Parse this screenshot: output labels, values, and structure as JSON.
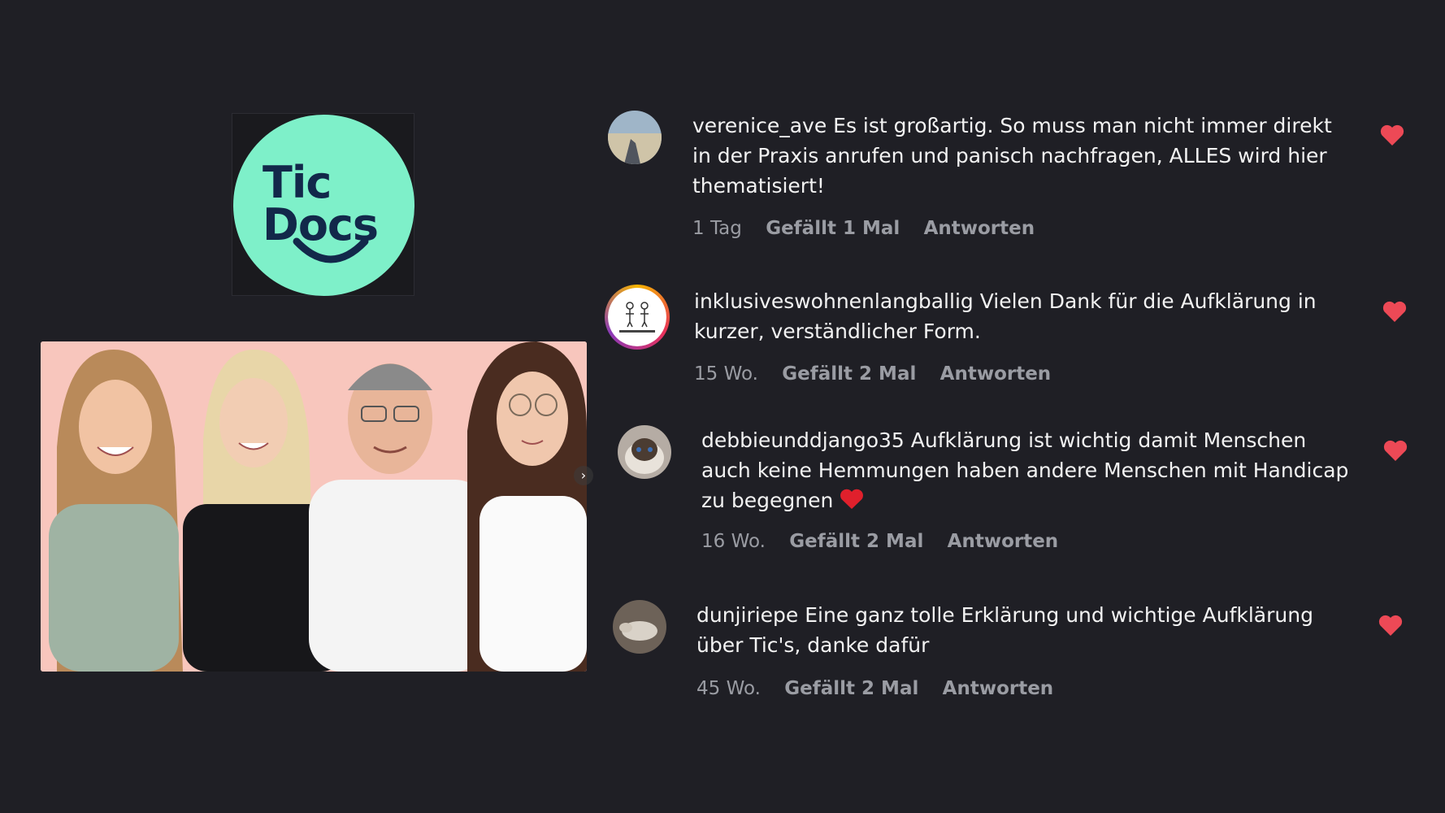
{
  "logo": {
    "line1": "Tic",
    "line2": "Docs"
  },
  "colors": {
    "background": "#1f1f25",
    "logo_circle": "#7ef0c9",
    "logo_text": "#12284a",
    "heart": "#ed4956",
    "meta_text": "#9a9ca3",
    "photo_background": "#f8c6bd"
  },
  "comments": [
    {
      "username": "verenice_ave",
      "text": "Es ist großartig. So muss man nicht immer direkt in der Praxis anrufen und panisch nachfragen, ALLES wird hier thematisiert!",
      "time": "1 Tag",
      "likes": "Gefällt 1 Mal",
      "reply": "Antworten",
      "liked": true
    },
    {
      "username": "inklusiveswohnenlangballig",
      "text": "Vielen Dank für die Aufklärung in kurzer, verständlicher Form.",
      "time": "15 Wo.",
      "likes": "Gefällt 2 Mal",
      "reply": "Antworten",
      "liked": true
    },
    {
      "username": "debbieunddjango35",
      "text": "Aufklärung ist wichtig damit Menschen auch keine Hemmungen haben andere Menschen mit Handicap zu begegnen",
      "time": "16 Wo.",
      "likes": "Gefällt 2 Mal",
      "reply": "Antworten",
      "liked": true
    },
    {
      "username": "dunjiriepe",
      "text": "Eine ganz tolle Erklärung und wichtige Aufklärung über Tic's, danke dafür",
      "time": "45 Wo.",
      "likes": "Gefällt 2 Mal",
      "reply": "Antworten",
      "liked": true
    }
  ]
}
